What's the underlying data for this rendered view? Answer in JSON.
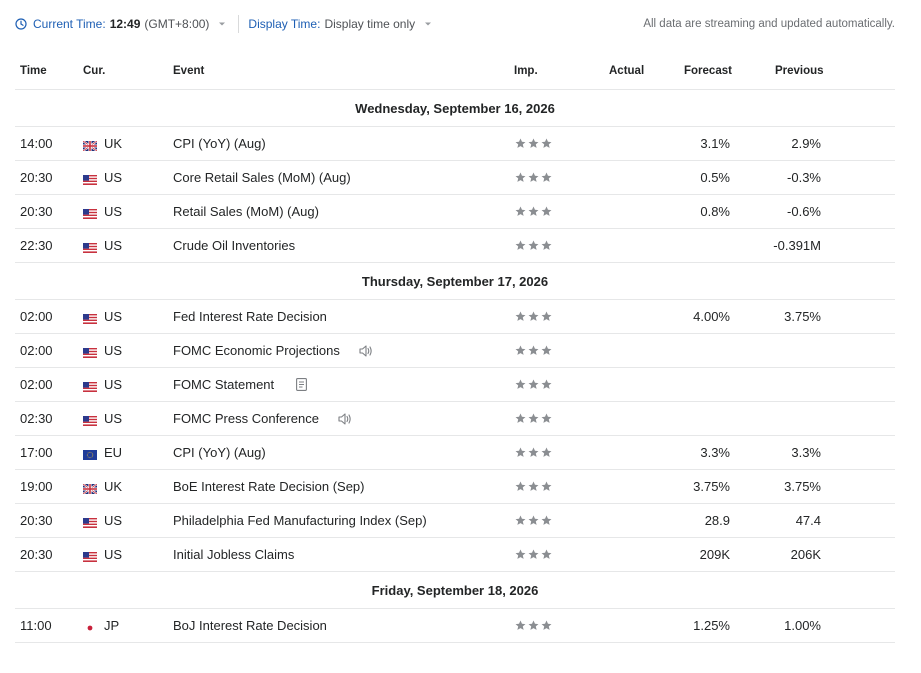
{
  "topbar": {
    "current_time_label": "Current Time:",
    "current_time_value": "12:49",
    "timezone": "(GMT+8:00)",
    "display_time_label": "Display Time:",
    "display_time_value": "Display time only",
    "status_text": "All data are streaming and updated automatically."
  },
  "columns": {
    "time": "Time",
    "currency": "Cur.",
    "event": "Event",
    "importance": "Imp.",
    "actual": "Actual",
    "forecast": "Forecast",
    "previous": "Previous"
  },
  "days": [
    {
      "date": "Wednesday, September 16, 2026",
      "events": [
        {
          "time": "14:00",
          "flag": "uk",
          "currency": "UK",
          "event": "CPI (YoY) (Aug)",
          "icon": "",
          "importance": 3,
          "actual": "",
          "forecast": "3.1%",
          "previous": "2.9%"
        },
        {
          "time": "20:30",
          "flag": "us",
          "currency": "US",
          "event": "Core Retail Sales (MoM) (Aug)",
          "icon": "",
          "importance": 3,
          "actual": "",
          "forecast": "0.5%",
          "previous": "-0.3%"
        },
        {
          "time": "20:30",
          "flag": "us",
          "currency": "US",
          "event": "Retail Sales (MoM) (Aug)",
          "icon": "",
          "importance": 3,
          "actual": "",
          "forecast": "0.8%",
          "previous": "-0.6%"
        },
        {
          "time": "22:30",
          "flag": "us",
          "currency": "US",
          "event": "Crude Oil Inventories",
          "icon": "",
          "importance": 3,
          "actual": "",
          "forecast": "",
          "previous": "-0.391M"
        }
      ]
    },
    {
      "date": "Thursday, September 17, 2026",
      "events": [
        {
          "time": "02:00",
          "flag": "us",
          "currency": "US",
          "event": "Fed Interest Rate Decision",
          "icon": "",
          "importance": 3,
          "actual": "",
          "forecast": "4.00%",
          "previous": "3.75%"
        },
        {
          "time": "02:00",
          "flag": "us",
          "currency": "US",
          "event": "FOMC Economic Projections",
          "icon": "speaker-icon",
          "importance": 3,
          "actual": "",
          "forecast": "",
          "previous": ""
        },
        {
          "time": "02:00",
          "flag": "us",
          "currency": "US",
          "event": "FOMC Statement",
          "icon": "document-icon",
          "importance": 3,
          "actual": "",
          "forecast": "",
          "previous": ""
        },
        {
          "time": "02:30",
          "flag": "us",
          "currency": "US",
          "event": "FOMC Press Conference",
          "icon": "speaker-icon",
          "importance": 3,
          "actual": "",
          "forecast": "",
          "previous": ""
        },
        {
          "time": "17:00",
          "flag": "eu",
          "currency": "EU",
          "event": "CPI (YoY) (Aug)",
          "icon": "",
          "importance": 3,
          "actual": "",
          "forecast": "3.3%",
          "previous": "3.3%"
        },
        {
          "time": "19:00",
          "flag": "uk",
          "currency": "UK",
          "event": "BoE Interest Rate Decision  (Sep)",
          "icon": "",
          "importance": 3,
          "actual": "",
          "forecast": "3.75%",
          "previous": "3.75%"
        },
        {
          "time": "20:30",
          "flag": "us",
          "currency": "US",
          "event": "Philadelphia Fed Manufacturing Index  (Sep)",
          "icon": "",
          "importance": 3,
          "actual": "",
          "forecast": "28.9",
          "previous": "47.4"
        },
        {
          "time": "20:30",
          "flag": "us",
          "currency": "US",
          "event": "Initial Jobless Claims",
          "icon": "",
          "importance": 3,
          "actual": "",
          "forecast": "209K",
          "previous": "206K"
        }
      ]
    },
    {
      "date": "Friday, September 18, 2026",
      "events": [
        {
          "time": "11:00",
          "flag": "jp",
          "currency": "JP",
          "event": "BoJ Interest Rate Decision",
          "icon": "",
          "importance": 3,
          "actual": "",
          "forecast": "1.25%",
          "previous": "1.00%"
        }
      ]
    }
  ],
  "colors": {
    "accent": "#1e5fb4",
    "star": "#8b8e92",
    "divider": "#e6e7e8"
  }
}
